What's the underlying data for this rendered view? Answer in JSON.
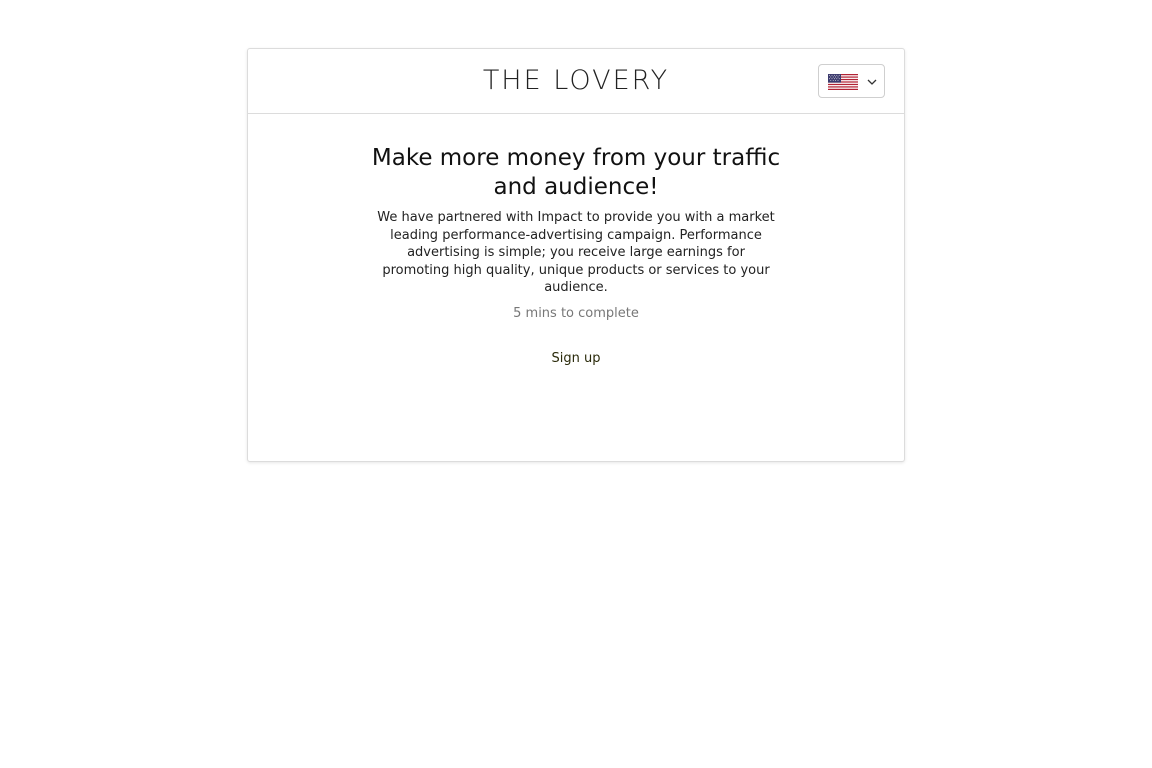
{
  "header": {
    "brand": "THE LOVERY",
    "language_selector": {
      "flag_icon": "us-flag-icon",
      "chevron_icon": "chevron-down-icon"
    }
  },
  "main": {
    "headline": "Make more money from your traffic and audience!",
    "description": "We have partnered with Impact to provide you with a market leading performance-advertising campaign. Performance advertising is simple; you receive large earnings for promoting high quality, unique products or services to your audience.",
    "duration": "5 mins to complete",
    "signup_label": "Sign up"
  },
  "colors": {
    "border": "#dcdcdc",
    "text": "#222222",
    "muted": "#777777",
    "link": "#2a2a0a"
  }
}
